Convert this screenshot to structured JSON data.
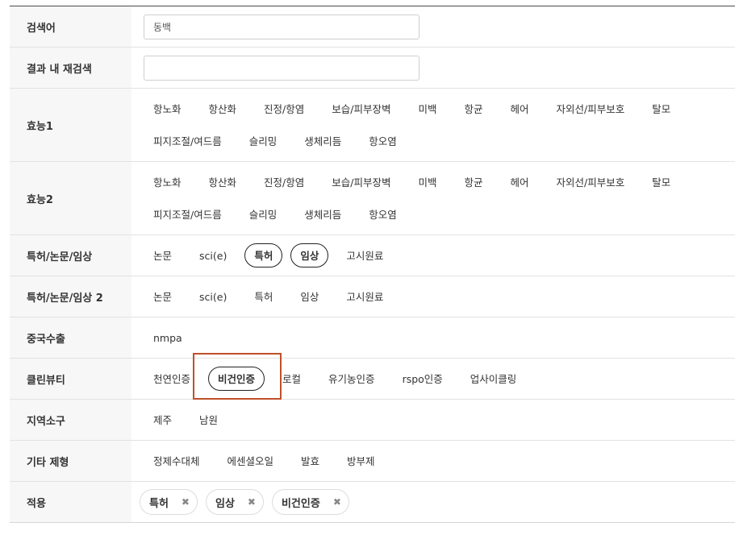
{
  "search": {
    "label": "검색어",
    "value": "동백",
    "re_label": "결과 내 재검색",
    "re_value": ""
  },
  "efficacy1": {
    "label": "효능1",
    "items": [
      "항노화",
      "항산화",
      "진정/항염",
      "보습/피부장벽",
      "미백",
      "항균",
      "헤어",
      "자외선/피부보호",
      "탈모",
      "피지조절/여드름",
      "슬리밍",
      "생체리듬",
      "항오염"
    ]
  },
  "efficacy2": {
    "label": "효능2",
    "items": [
      "항노화",
      "항산화",
      "진정/항염",
      "보습/피부장벽",
      "미백",
      "항균",
      "헤어",
      "자외선/피부보호",
      "탈모",
      "피지조절/여드름",
      "슬리밍",
      "생체리듬",
      "항오염"
    ]
  },
  "patent1": {
    "label": "특허/논문/임상",
    "items": [
      "논문",
      "sci(e)",
      "특허",
      "임상",
      "고시원료"
    ],
    "selected": [
      "특허",
      "임상"
    ]
  },
  "patent2": {
    "label": "특허/논문/임상 2",
    "items": [
      "논문",
      "sci(e)",
      "특허",
      "임상",
      "고시원료"
    ]
  },
  "china": {
    "label": "중국수출",
    "items": [
      "nmpa"
    ]
  },
  "clean": {
    "label": "클린뷰티",
    "items": [
      "천연인증",
      "비건인증",
      "로컬",
      "유기농인증",
      "rspo인증",
      "업사이클링"
    ],
    "selected": [
      "비건인증"
    ]
  },
  "region": {
    "label": "지역소구",
    "items": [
      "제주",
      "남원"
    ]
  },
  "other": {
    "label": "기타 제형",
    "items": [
      "정제수대체",
      "에센셜오일",
      "발효",
      "방부제"
    ]
  },
  "applied": {
    "label": "적용",
    "tags": [
      "특허",
      "임상",
      "비건인증"
    ],
    "remove_glyph": "✖"
  },
  "colors": {
    "highlight": "#c0502a",
    "label_bg": "#f7f7f7"
  }
}
